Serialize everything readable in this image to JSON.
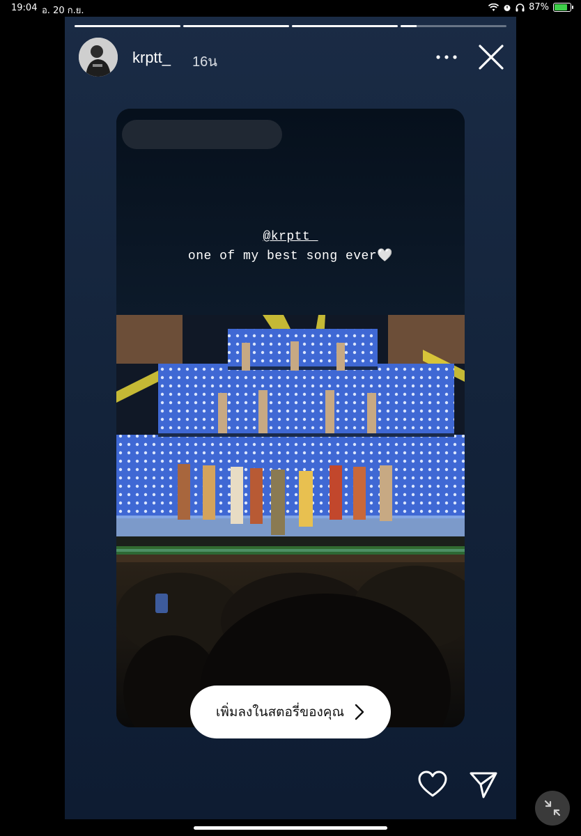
{
  "status_bar": {
    "time": "19:04",
    "date": "อ. 20 ก.ย.",
    "battery": "87%",
    "icons": [
      "wifi-icon",
      "alarm-icon",
      "headphones-icon",
      "battery-icon"
    ]
  },
  "story": {
    "progress": [
      1,
      1,
      1,
      0.15
    ],
    "user": {
      "name": "krptt_",
      "time_ago": "16น"
    },
    "mention": "@krptt_",
    "caption": "one of my best song ever🤍",
    "add_to_story_label": "เพิ่มลงในสตอรี่ของคุณ",
    "icons": [
      "more-icon",
      "close-icon",
      "heart-icon",
      "send-icon",
      "chevron-right-icon",
      "shrink-icon"
    ]
  },
  "colors": {
    "story_bg": "#13233a",
    "battery_fill": "#3ecf4a",
    "stage_blue": "#4f7fe0",
    "light_yellow": "#f2e23a"
  }
}
